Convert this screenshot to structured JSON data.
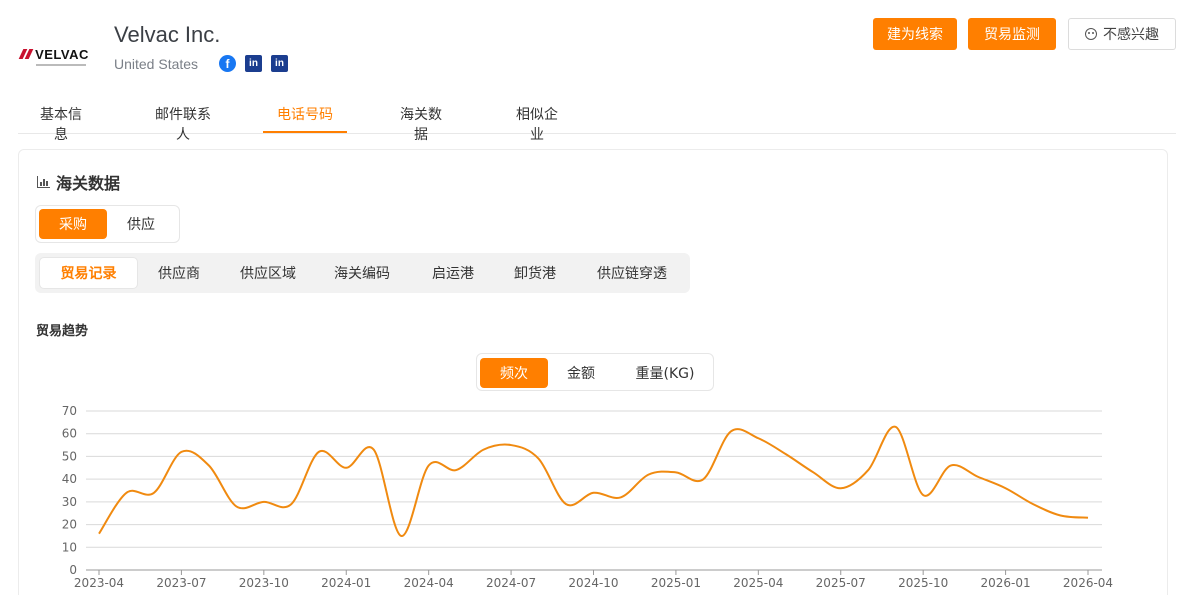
{
  "company": {
    "logo_text": "VELVAC",
    "name": "Velvac Inc.",
    "country": "United States",
    "socials": [
      {
        "icon": "facebook-icon",
        "glyph": "f"
      },
      {
        "icon": "linkedin-icon",
        "glyph": "in"
      },
      {
        "icon": "linkedin-icon",
        "glyph": "in"
      }
    ]
  },
  "header_buttons": {
    "lead": "建为线索",
    "monitor": "贸易监测",
    "not_interested": "不感兴趣"
  },
  "tabs": [
    "基本信息",
    "邮件联系人",
    "电话号码",
    "海关数据",
    "相似企业"
  ],
  "active_tab": "电话号码",
  "panel": {
    "title": "海关数据",
    "segment1": [
      "采购",
      "供应"
    ],
    "subtabs": [
      "贸易记录",
      "供应商",
      "供应区域",
      "海关编码",
      "启运港",
      "卸货港",
      "供应链穿透"
    ],
    "trend_label": "贸易趋势",
    "segment2": [
      "频次",
      "金额",
      "重量(KG)"
    ]
  },
  "colors": {
    "accent": "#ff7f00",
    "line": "#f08a10"
  },
  "chart_data": {
    "type": "line",
    "title": "",
    "xlabel": "",
    "ylabel": "",
    "ylim": [
      0,
      70
    ],
    "yticks": [
      0,
      10,
      20,
      30,
      40,
      50,
      60,
      70
    ],
    "xticks": [
      "2023-04",
      "2023-07",
      "2023-10",
      "2024-01",
      "2024-04",
      "2024-07",
      "2024-10",
      "2025-01",
      "2025-04",
      "2025-07",
      "2025-10",
      "2026-01",
      "2026-04"
    ],
    "grid": true,
    "series": [
      {
        "name": "",
        "x": [
          "2023-04",
          "2023-05",
          "2023-06",
          "2023-07",
          "2023-08",
          "2023-09",
          "2023-10",
          "2023-11",
          "2023-12",
          "2024-01",
          "2024-02",
          "2024-03",
          "2024-04",
          "2024-05",
          "2024-06",
          "2024-07",
          "2024-08",
          "2024-09",
          "2024-10",
          "2024-11",
          "2024-12",
          "2025-01",
          "2025-02",
          "2025-03",
          "2025-04",
          "2025-05",
          "2025-06",
          "2025-07",
          "2025-08",
          "2025-09",
          "2025-10",
          "2025-11",
          "2025-12",
          "2026-01",
          "2026-02",
          "2026-03",
          "2026-04"
        ],
        "values": [
          16,
          34,
          34,
          52,
          46,
          28,
          30,
          29,
          52,
          45,
          53,
          15,
          46,
          44,
          53,
          55,
          49,
          29,
          34,
          32,
          42,
          43,
          40,
          61,
          58,
          51,
          43,
          36,
          44,
          63,
          33,
          46,
          41,
          36,
          29,
          24,
          23
        ]
      }
    ]
  }
}
